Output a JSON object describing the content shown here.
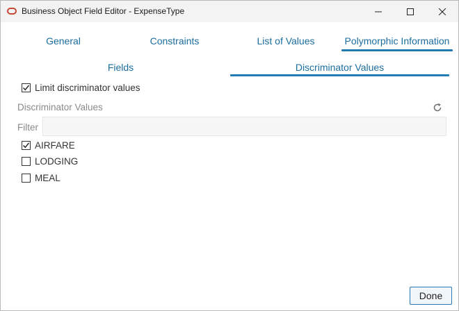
{
  "window": {
    "title": "Business Object Field Editor - ExpenseType",
    "controls": {
      "minimize": "minimize-icon",
      "maximize": "maximize-icon",
      "close": "close-icon"
    }
  },
  "tabs": [
    {
      "label": "General",
      "active": false
    },
    {
      "label": "Constraints",
      "active": false
    },
    {
      "label": "List of Values",
      "active": false
    },
    {
      "label": "Polymorphic Information",
      "active": true
    }
  ],
  "subtabs": [
    {
      "label": "Fields",
      "active": false
    },
    {
      "label": "Discriminator Values",
      "active": true
    }
  ],
  "limit_checkbox": {
    "label": "Limit discriminator values",
    "checked": true
  },
  "section": {
    "label": "Discriminator Values",
    "refresh_icon": "refresh-icon"
  },
  "filter": {
    "label": "Filter",
    "value": "",
    "placeholder": ""
  },
  "values": [
    {
      "label": "AIRFARE",
      "checked": true
    },
    {
      "label": "LODGING",
      "checked": false
    },
    {
      "label": "MEAL",
      "checked": false
    }
  ],
  "footer": {
    "done_label": "Done"
  },
  "colors": {
    "accent": "#227ab3",
    "tab_text": "#1b6d9e",
    "oracle_red": "#c74634"
  }
}
